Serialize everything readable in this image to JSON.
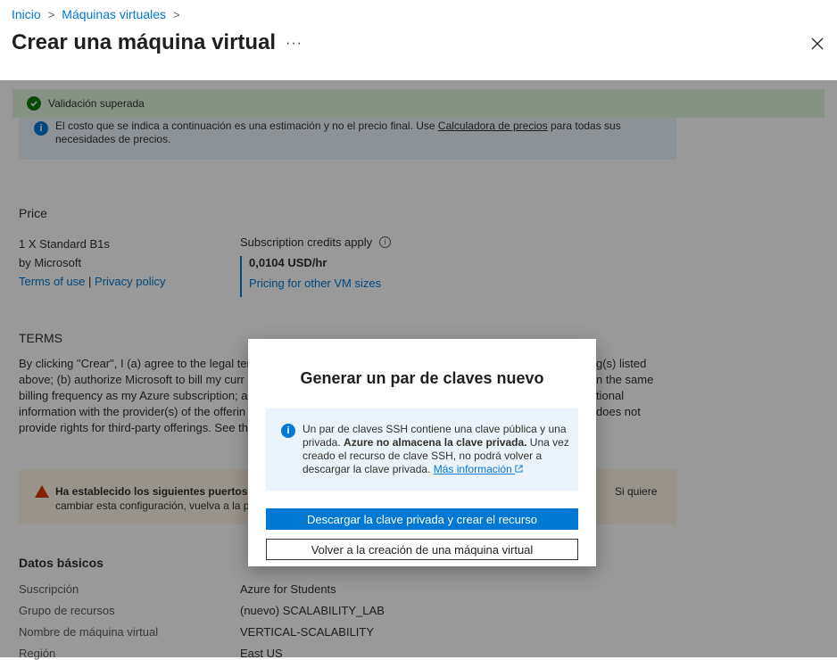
{
  "breadcrumb": {
    "home": "Inicio",
    "vms": "Máquinas virtuales"
  },
  "page_title": "Crear una máquina virtual",
  "more_label": "···",
  "validation": "Validación superada",
  "info_banner": {
    "line1_a": "El costo que se indica a continuación es una estimación y no el precio final. Use ",
    "line1_link": "Calculadora de precios",
    "line1_b": " para todas sus",
    "line2": "necesidades de precios."
  },
  "price": {
    "heading": "Price",
    "plan": "1 X Standard B1s",
    "publisher": "by Microsoft",
    "terms_link": "Terms of use",
    "separator": " | ",
    "privacy_link": "Privacy policy",
    "credits": "Subscription credits apply",
    "amount": "0,0104 USD/hr",
    "other_sizes": "Pricing for other VM sizes"
  },
  "terms": {
    "heading": "TERMS",
    "lines": [
      "By clicking \"Crear\", I (a) agree to the legal ter",
      "above; (b) authorize Microsoft to bill my curr",
      "billing frequency as my Azure subscription; a",
      "information with the provider(s) of the offerin",
      "provide rights for third-party offerings. See th"
    ],
    "right_lines": [
      "g(s) listed",
      "n the same",
      "tional",
      "does not"
    ]
  },
  "warning": {
    "line1": "Ha establecido los siguientes puertos a",
    "line1_right": "Si quiere",
    "line2": "cambiar esta configuración, vuelva a la p"
  },
  "basics": {
    "heading": "Datos básicos",
    "rows": [
      {
        "k": "Suscripción",
        "v": "Azure for Students"
      },
      {
        "k": "Grupo de recursos",
        "v": "(nuevo) SCALABILITY_LAB"
      },
      {
        "k": "Nombre de máquina virtual",
        "v": "VERTICAL-SCALABILITY"
      },
      {
        "k": "Región",
        "v": "East US"
      }
    ]
  },
  "dialog": {
    "title": "Generar un par de claves nuevo",
    "info_a": "Un par de claves SSH contiene una clave pública y una privada. ",
    "info_bold": "Azure no almacena la clave privada.",
    "info_b": " Una vez creado el recurso de clave SSH, no podrá volver a descargar la clave privada. ",
    "info_link": "Más información",
    "primary_button": "Descargar la clave privada y crear el recurso",
    "secondary_button": "Volver a la creación de una máquina virtual"
  },
  "colors": {
    "accent": "#0078d4",
    "success": "#107c10",
    "warning": "#d83b01"
  }
}
